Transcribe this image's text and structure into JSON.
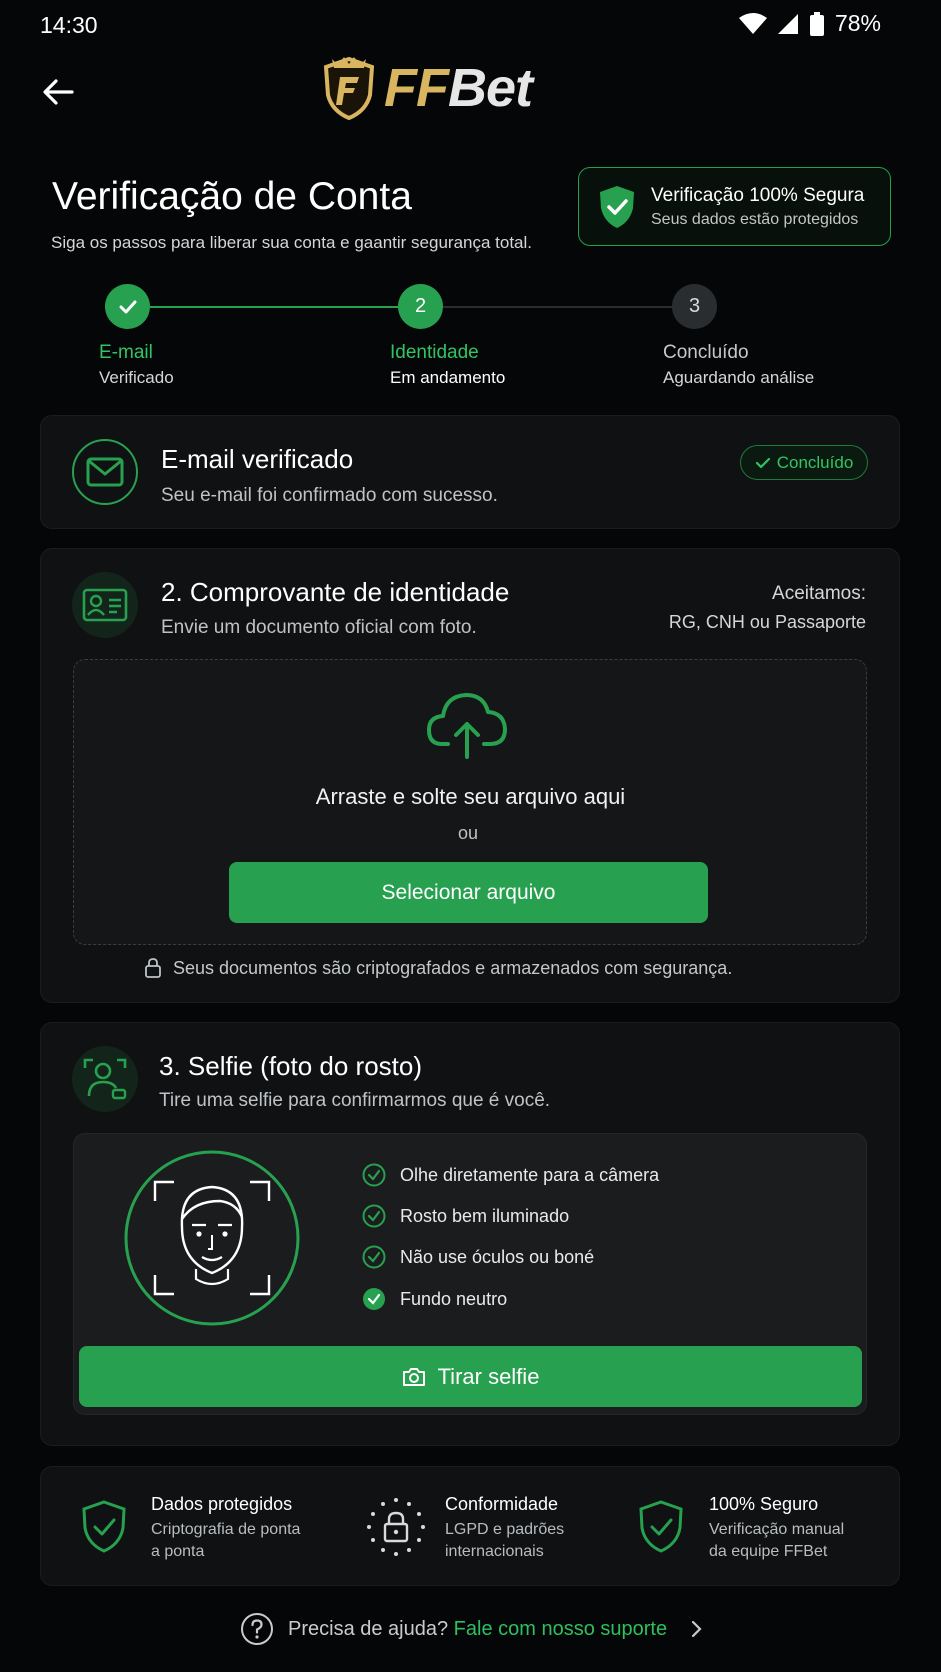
{
  "status_bar": {
    "time": "14:30",
    "battery": "78%"
  },
  "header": {
    "logo_ff": "FF",
    "logo_bet": "Bet"
  },
  "title": "Verificação de Conta",
  "subtitle": "Siga os passos para liberar sua conta e gaantir segurança total.",
  "secure_badge": {
    "title": "Verificação 100% Segura",
    "subtitle": "Seus dados estão protegidos"
  },
  "steps": [
    {
      "label": "E-mail",
      "status": "Verificado"
    },
    {
      "number": "2",
      "label": "Identidade",
      "status": "Em andamento"
    },
    {
      "number": "3",
      "label": "Concluído",
      "status": "Aguardando análise"
    }
  ],
  "email_card": {
    "title": "E-mail verificado",
    "subtitle": "Seu e-mail foi confirmado com sucesso.",
    "badge": "Concluído"
  },
  "id_card": {
    "title": "2. Comprovante de identidade",
    "subtitle": "Envie um documento oficial com foto.",
    "accepted_label": "Aceitamos:",
    "accepted_docs": "RG, CNH ou Passaporte",
    "drop_text": "Arraste e solte seu arquivo aqui",
    "or": "ou",
    "select_button": "Selecionar arquivo",
    "security_note": "Seus documentos são criptografados e armazenados com segurança."
  },
  "selfie_card": {
    "title": "3. Selfie (foto do rosto)",
    "subtitle": "Tire uma selfie para confirmarmos que é você.",
    "checklist": [
      "Olhe diretamente para a câmera",
      "Rosto bem iluminado",
      "Não use óculos ou boné",
      "Fundo neutro"
    ],
    "button": "Tirar selfie"
  },
  "features": [
    {
      "title": "Dados protegidos",
      "line1": "Criptografia de ponta",
      "line2": "a ponta",
      "icon": "shield-check-icon"
    },
    {
      "title": "Conformidade",
      "line1": "LGPD e padrões",
      "line2": "internacionais",
      "icon": "lock-stars-icon"
    },
    {
      "title": "100% Seguro",
      "line1": "Verificação manual",
      "line2": "da equipe FFBet",
      "icon": "shield-check-icon"
    }
  ],
  "help": {
    "text": "Precisa de ajuda?",
    "link": "Fale com nosso suporte"
  },
  "colors": {
    "accent": "#27a150",
    "accent_text": "#2fbf5e",
    "background": "#050607",
    "card": "#0f1112",
    "gold": "#d9b55f"
  }
}
